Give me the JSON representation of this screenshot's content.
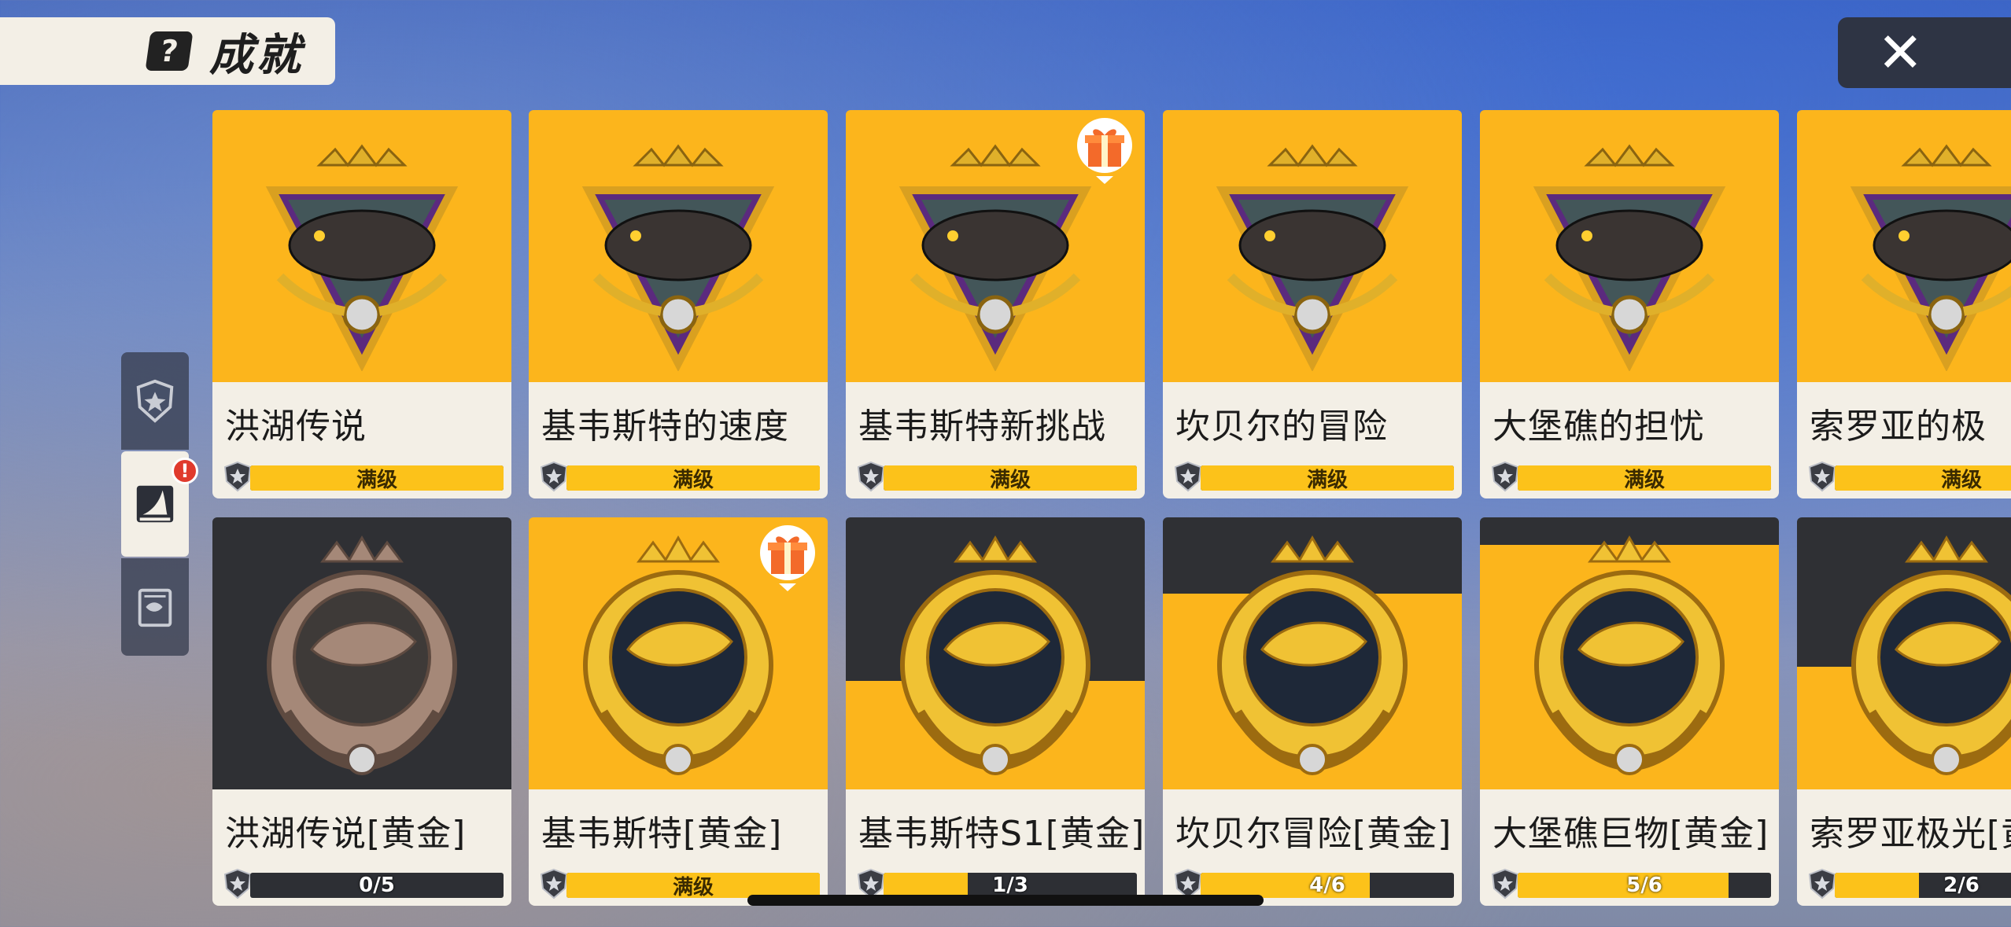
{
  "header": {
    "title": "成就",
    "title_icon": "?",
    "close_label": "✕"
  },
  "side_tabs": [
    {
      "icon": "shield-star-icon",
      "active": false,
      "alert": false
    },
    {
      "icon": "shark-fin-icon",
      "active": true,
      "alert": true,
      "alert_label": "!"
    },
    {
      "icon": "notebook-fish-icon",
      "active": false,
      "alert": false
    }
  ],
  "colors": {
    "accent_gold": "#fcb51c",
    "dark_panel": "#2f3034",
    "card_bottom": "#f3efe6"
  },
  "rows": [
    {
      "cards": [
        {
          "name": "洪湖传说",
          "progress_text": "满级",
          "progress": 1.0,
          "style": "gold",
          "fish": "arapaima",
          "gift": false
        },
        {
          "name": "基韦斯特的速度",
          "progress_text": "满级",
          "progress": 1.0,
          "style": "gold",
          "fish": "sailfish",
          "gift": false
        },
        {
          "name": "基韦斯特新挑战",
          "progress_text": "满级",
          "progress": 1.0,
          "style": "gold",
          "fish": "white-marlin",
          "gift": true
        },
        {
          "name": "坎贝尔的冒险",
          "progress_text": "满级",
          "progress": 1.0,
          "style": "gold",
          "fish": "sturgeon",
          "gift": false
        },
        {
          "name": "大堡礁的担忧",
          "progress_text": "满级",
          "progress": 1.0,
          "style": "gold",
          "fish": "shark",
          "gift": false
        },
        {
          "name": "索罗亚的极",
          "progress_text": "满级",
          "progress": 1.0,
          "style": "gold",
          "fish": "shark-gray",
          "gift": false
        }
      ]
    },
    {
      "cards": [
        {
          "name": "洪湖传说[黄金]",
          "progress_text": "0/5",
          "progress": 0.0,
          "style": "dark",
          "fill_level": 0.0,
          "gift": false
        },
        {
          "name": "基韦斯特[黄金]",
          "progress_text": "满级",
          "progress": 1.0,
          "style": "gold",
          "fill_level": 1.0,
          "gift": true
        },
        {
          "name": "基韦斯特S1[黄金]",
          "progress_text": "1/3",
          "progress": 0.333,
          "style": "split",
          "fill_level": 0.4,
          "gift": false
        },
        {
          "name": "坎贝尔冒险[黄金]",
          "progress_text": "4/6",
          "progress": 0.667,
          "style": "split",
          "fill_level": 0.72,
          "gift": false
        },
        {
          "name": "大堡礁巨物[黄金]",
          "progress_text": "5/6",
          "progress": 0.833,
          "style": "split",
          "fill_level": 0.9,
          "gift": false
        },
        {
          "name": "索罗亚极光[黄",
          "progress_text": "2/6",
          "progress": 0.333,
          "style": "split",
          "fill_level": 0.45,
          "gift": false
        }
      ]
    }
  ]
}
